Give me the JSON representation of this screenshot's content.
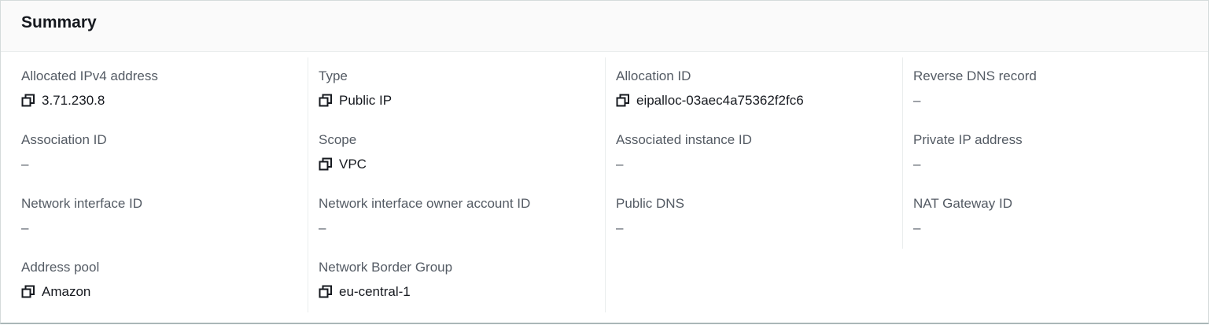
{
  "header": {
    "title": "Summary"
  },
  "columns": [
    {
      "fields": [
        {
          "label": "Allocated IPv4 address",
          "value": "3.71.230.8",
          "copyable": true
        },
        {
          "label": "Association ID",
          "value": "–",
          "copyable": false
        },
        {
          "label": "Network interface ID",
          "value": "–",
          "copyable": false
        },
        {
          "label": "Address pool",
          "value": "Amazon",
          "copyable": true
        }
      ]
    },
    {
      "fields": [
        {
          "label": "Type",
          "value": "Public IP",
          "copyable": true
        },
        {
          "label": "Scope",
          "value": "VPC",
          "copyable": true
        },
        {
          "label": "Network interface owner account ID",
          "value": "–",
          "copyable": false
        },
        {
          "label": "Network Border Group",
          "value": "eu-central-1",
          "copyable": true
        }
      ]
    },
    {
      "fields": [
        {
          "label": "Allocation ID",
          "value": "eipalloc-03aec4a75362f2fc6",
          "copyable": true
        },
        {
          "label": "Associated instance ID",
          "value": "–",
          "copyable": false
        },
        {
          "label": "Public DNS",
          "value": "–",
          "copyable": false
        }
      ]
    },
    {
      "fields": [
        {
          "label": "Reverse DNS record",
          "value": "–",
          "copyable": false
        },
        {
          "label": "Private IP address",
          "value": "–",
          "copyable": false
        },
        {
          "label": "NAT Gateway ID",
          "value": "–",
          "copyable": false
        }
      ]
    }
  ],
  "icons": {
    "copy": "copy-icon"
  },
  "colors": {
    "label": "#545b64",
    "value": "#16191f",
    "divider": "#eaeded",
    "header_bg": "#fafafa"
  }
}
